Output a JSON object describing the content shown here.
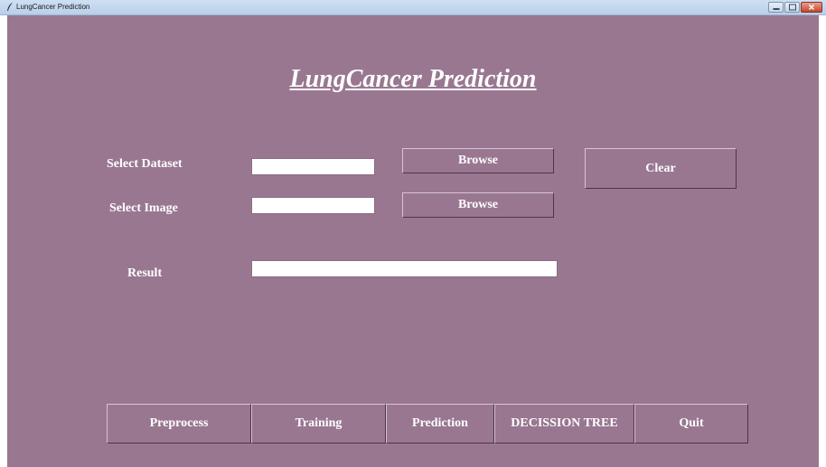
{
  "window": {
    "title": "LungCancer Prediction"
  },
  "header": {
    "title": "LungCancer Prediction"
  },
  "form": {
    "dataset_label": "Select Dataset",
    "dataset_value": "",
    "dataset_browse": "Browse",
    "image_label": "Select Image",
    "image_value": "",
    "image_browse": "Browse",
    "clear_label": "Clear",
    "result_label": "Result",
    "result_value": ""
  },
  "toolbar": {
    "preprocess": "Preprocess",
    "training": "Training",
    "prediction": "Prediction",
    "decision_tree": "DECISSION TREE",
    "quit": "Quit"
  },
  "colors": {
    "background": "#997791",
    "text": "#ffffff"
  }
}
